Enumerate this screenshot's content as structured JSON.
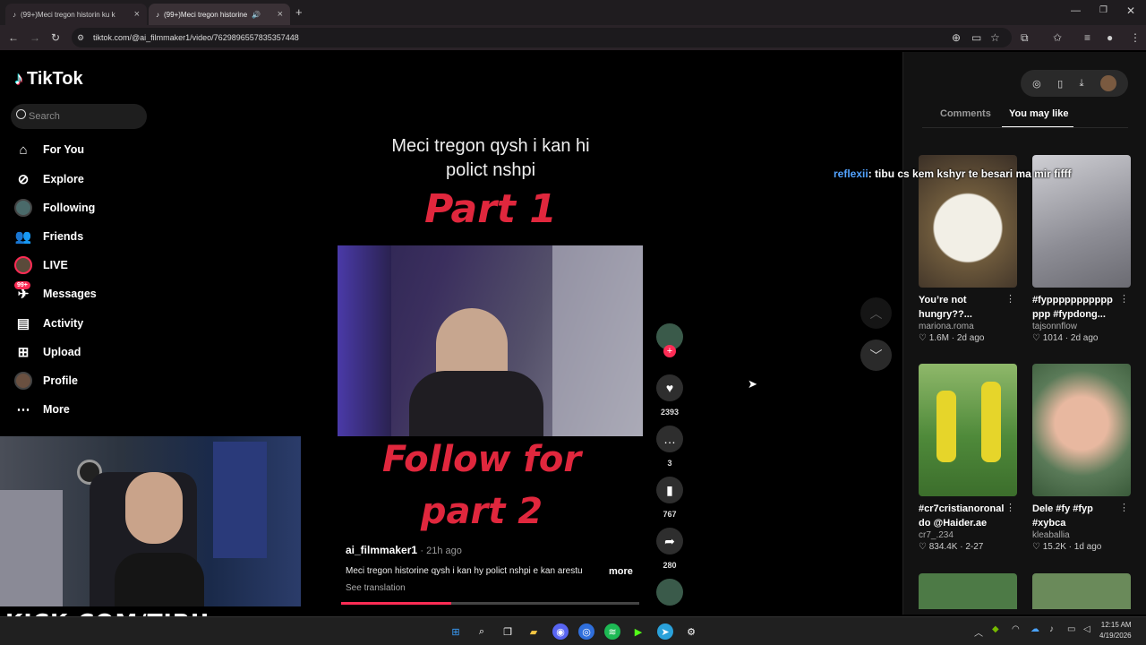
{
  "browser": {
    "tabs": [
      {
        "label": "(99+)Meci tregon historin ku k"
      },
      {
        "label": "(99+)Meci tregon historine"
      }
    ],
    "url": "tiktok.com/@ai_filmmaker1/video/7629896557835357448"
  },
  "sidebar": {
    "logo": "TikTok",
    "search_placeholder": "Search",
    "items": [
      {
        "label": "For You",
        "icon": "home-icon"
      },
      {
        "label": "Explore",
        "icon": "compass-icon"
      },
      {
        "label": "Following",
        "icon": "following-avatar-icon"
      },
      {
        "label": "Friends",
        "icon": "friends-icon"
      },
      {
        "label": "LIVE",
        "icon": "live-icon"
      },
      {
        "label": "Messages",
        "icon": "messages-icon",
        "badge": "99+"
      },
      {
        "label": "Activity",
        "icon": "activity-icon"
      },
      {
        "label": "Upload",
        "icon": "upload-icon"
      },
      {
        "label": "Profile",
        "icon": "profile-avatar-icon"
      },
      {
        "label": "More",
        "icon": "more-icon"
      }
    ]
  },
  "video": {
    "title_line1": "Meci tregon qysh i  kan hi",
    "title_line2": "polict nshpi",
    "overlay_part": "Part 1",
    "overlay_follow1": "Follow for",
    "overlay_follow2": "part 2",
    "author": "ai_filmmaker1",
    "posted": "· 21h ago",
    "description": "Meci tregon historine qysh i kan hy polict nshpi e kan arestu",
    "more_label": "more",
    "translate_label": "See translation",
    "progress_fraction": 0.37
  },
  "actions": {
    "likes": "2393",
    "comments": "3",
    "saves": "767",
    "shares": "280"
  },
  "right_panel": {
    "tabs": [
      "Comments",
      "You may like"
    ],
    "active_tab": "You may like",
    "cards": [
      {
        "caption": "You’re not hungry??...",
        "author": "mariona.roma",
        "likes": "1.6M",
        "age": "2d ago"
      },
      {
        "caption": "#fyppppppppppp ppp #fypdong...",
        "author": "tajsonnflow",
        "likes": "1014",
        "age": "2d ago"
      },
      {
        "caption": "#cr7cristianoronal do @Haider.ae",
        "author": "cr7_.234",
        "likes": "834.4K",
        "age": "2-27"
      },
      {
        "caption": "Dele #fy #fyp #xybca",
        "author": "kleaballia",
        "likes": "15.2K",
        "age": "1d ago"
      }
    ]
  },
  "chat": {
    "user": "reflexii",
    "message": ": tibu cs kem kshyr te besari ma mir fifff"
  },
  "stream": {
    "brand": "KICK.COM/TIBU"
  },
  "clock": {
    "time": "12:15 AM",
    "date": "4/19/2026"
  },
  "colors": {
    "accent": "#fe2c55",
    "overlay_red": "#e0273d",
    "chat_user": "#53a3ff"
  }
}
